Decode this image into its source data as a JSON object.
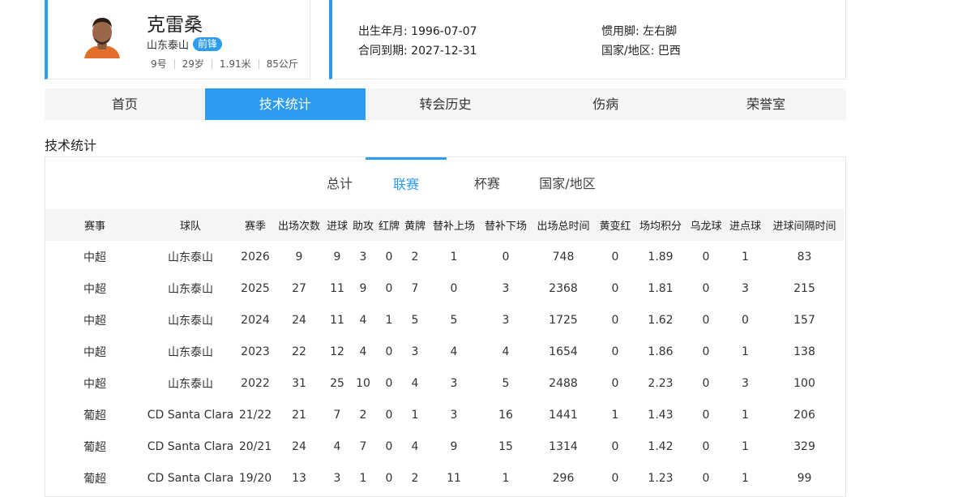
{
  "player": {
    "name": "克雷桑",
    "team": "山东泰山",
    "position": "前锋",
    "number": "9号",
    "age": "29岁",
    "height": "1.91米",
    "weight": "85公斤"
  },
  "info": {
    "birth": "出生年月: 1996-07-07",
    "contract": "合同到期: 2027-12-31",
    "foot": "惯用脚: 左右脚",
    "nationality": "国家/地区: 巴西"
  },
  "main_tabs": [
    "首页",
    "技术统计",
    "转会历史",
    "伤病",
    "荣誉室"
  ],
  "section_title": "技术统计",
  "sub_tabs": [
    "总计",
    "联赛",
    "杯赛",
    "国家/地区"
  ],
  "table": {
    "headers": [
      "赛事",
      "球队",
      "赛季",
      "出场次数",
      "进球",
      "助攻",
      "红牌",
      "黄牌",
      "替补上场",
      "替补下场",
      "出场总时间",
      "黄变红",
      "场均积分",
      "乌龙球",
      "进点球",
      "进球间隔时间"
    ],
    "rows": [
      [
        "中超",
        "山东泰山",
        "2026",
        "9",
        "9",
        "3",
        "0",
        "2",
        "1",
        "0",
        "748",
        "0",
        "1.89",
        "0",
        "1",
        "83"
      ],
      [
        "中超",
        "山东泰山",
        "2025",
        "27",
        "11",
        "9",
        "0",
        "7",
        "0",
        "3",
        "2368",
        "0",
        "1.81",
        "0",
        "3",
        "215"
      ],
      [
        "中超",
        "山东泰山",
        "2024",
        "24",
        "11",
        "4",
        "1",
        "5",
        "5",
        "3",
        "1725",
        "0",
        "1.62",
        "0",
        "0",
        "157"
      ],
      [
        "中超",
        "山东泰山",
        "2023",
        "22",
        "12",
        "4",
        "0",
        "3",
        "4",
        "4",
        "1654",
        "0",
        "1.86",
        "0",
        "1",
        "138"
      ],
      [
        "中超",
        "山东泰山",
        "2022",
        "31",
        "25",
        "10",
        "0",
        "4",
        "3",
        "5",
        "2488",
        "0",
        "2.23",
        "0",
        "3",
        "100"
      ],
      [
        "葡超",
        "CD Santa Clara",
        "21/22",
        "21",
        "7",
        "2",
        "0",
        "1",
        "3",
        "16",
        "1441",
        "1",
        "1.43",
        "0",
        "1",
        "206"
      ],
      [
        "葡超",
        "CD Santa Clara",
        "20/21",
        "24",
        "4",
        "7",
        "0",
        "4",
        "9",
        "15",
        "1314",
        "0",
        "1.42",
        "0",
        "1",
        "329"
      ],
      [
        "葡超",
        "CD Santa Clara",
        "19/20",
        "13",
        "3",
        "1",
        "0",
        "2",
        "11",
        "1",
        "296",
        "0",
        "1.23",
        "0",
        "1",
        "99"
      ]
    ]
  },
  "colors": {
    "accent": "#2d9bf0",
    "tab_bg": "#f5f5f5",
    "border": "#e6e6e6"
  }
}
